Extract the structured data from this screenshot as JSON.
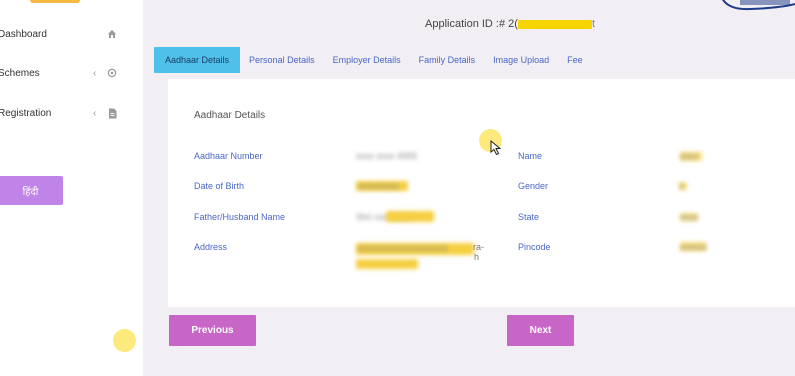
{
  "sidebar": {
    "items": [
      {
        "label": "Dashboard",
        "icon": "home-icon"
      },
      {
        "label": "Schemes",
        "icon": "gear-icon"
      },
      {
        "label": "Registration",
        "icon": "document-icon"
      }
    ],
    "language_button": "हिंदी"
  },
  "header": {
    "application_id_label": "Application ID :# 2(",
    "application_id_suffix": "t"
  },
  "tabs": [
    {
      "label": "Aadhaar Details",
      "active": true
    },
    {
      "label": "Personal Details",
      "active": false
    },
    {
      "label": "Employer Details",
      "active": false
    },
    {
      "label": "Family Details",
      "active": false
    },
    {
      "label": "Image Upload",
      "active": false
    },
    {
      "label": "Fee",
      "active": false
    }
  ],
  "card": {
    "title": "Aadhaar Details",
    "left_fields": [
      {
        "label": "Aadhaar Number",
        "value": "xxxx xxxx 4955"
      },
      {
        "label": "Date of Birth",
        "value": "xx/xx/xxxx"
      },
      {
        "label": "Father/Husband Name",
        "value": "Shri xxxxxxxx"
      },
      {
        "label": "Address",
        "value": "xxxxxxxxxxxxxxxxxxxx",
        "value_suffix": "ra-",
        "value_suffix2": "h"
      }
    ],
    "right_fields": [
      {
        "label": "Name",
        "value": "xxxx"
      },
      {
        "label": "Gender",
        "value": "x"
      },
      {
        "label": "State",
        "value": "xxxx"
      },
      {
        "label": "Pincode",
        "value": "xxxxxx"
      }
    ]
  },
  "buttons": {
    "previous": "Previous",
    "next": "Next"
  },
  "colors": {
    "active_tab": "#4fc0ea",
    "primary_button": "#c766c7",
    "language_button": "#c084e8",
    "label_blue": "#4a66c8"
  }
}
